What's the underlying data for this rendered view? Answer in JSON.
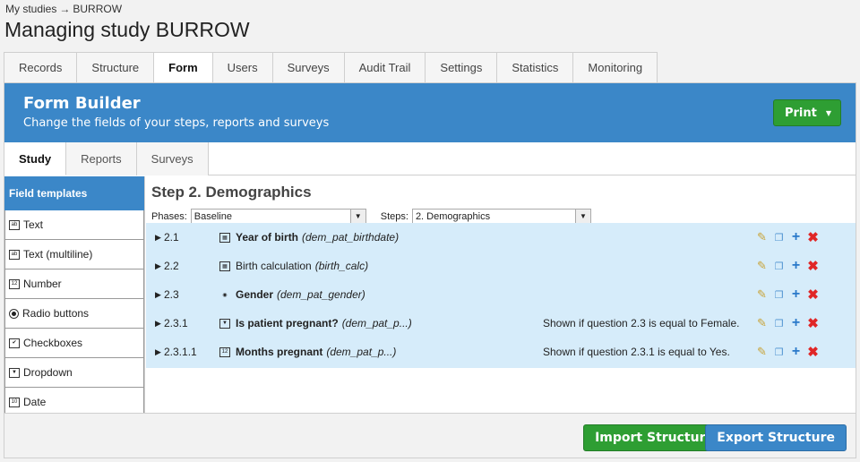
{
  "breadcrumb": {
    "root": "My studies",
    "arrow": "→",
    "current": "BURROW"
  },
  "page_title": "Managing study BURROW",
  "tabs": [
    "Records",
    "Structure",
    "Form",
    "Users",
    "Surveys",
    "Audit Trail",
    "Settings",
    "Statistics",
    "Monitoring"
  ],
  "active_tab": "Form",
  "banner": {
    "title": "Form Builder",
    "subtitle": "Change the fields of your steps, reports and surveys",
    "print_label": "Print",
    "print_caret": "▼"
  },
  "subtabs": [
    "Study",
    "Reports",
    "Surveys"
  ],
  "sidebar": {
    "heading": "Field templates",
    "items": [
      {
        "label": "Text",
        "icon": "text-icon",
        "glyph": "ab"
      },
      {
        "label": "Text (multiline)",
        "icon": "text-multiline-icon",
        "glyph": "ab"
      },
      {
        "label": "Number",
        "icon": "number-icon",
        "glyph": "12"
      },
      {
        "label": "Radio buttons",
        "icon": "radio-icon",
        "glyph": ""
      },
      {
        "label": "Checkboxes",
        "icon": "checkbox-icon",
        "glyph": "✔"
      },
      {
        "label": "Dropdown",
        "icon": "dropdown-icon",
        "glyph": "▼"
      },
      {
        "label": "Date",
        "icon": "date-icon",
        "glyph": "10"
      }
    ]
  },
  "step": {
    "title": "Step 2. Demographics",
    "phases_label": "Phases:",
    "phase_value": "Baseline",
    "steps_label": "Steps:",
    "step_value": "2. Demographics",
    "select_arrow": "▼"
  },
  "fields": [
    {
      "num": "2.1",
      "name": "Year of birth",
      "var": "(dem_pat_birthdate)",
      "bold": true,
      "icon": "calendar-icon",
      "glyph": "▦",
      "cond": ""
    },
    {
      "num": "2.2",
      "name": "Birth calculation",
      "var": "(birth_calc)",
      "bold": false,
      "icon": "calculation-icon",
      "glyph": "▦",
      "cond": ""
    },
    {
      "num": "2.3",
      "name": "Gender",
      "var": "(dem_pat_gender)",
      "bold": true,
      "icon": "radio-icon",
      "glyph": "◉",
      "cond": ""
    },
    {
      "num": "2.3.1",
      "name": "Is patient pregnant?",
      "var": "(dem_pat_p...)",
      "bold": true,
      "icon": "dropdown-icon",
      "glyph": "▼",
      "cond": "Shown if question 2.3 is equal to Female."
    },
    {
      "num": "2.3.1.1",
      "name": "Months pregnant",
      "var": "(dem_pat_p...)",
      "bold": true,
      "icon": "number-icon",
      "glyph": "12",
      "cond": "Shown if question 2.3.1 is equal to Yes."
    }
  ],
  "row_triangle": "▶",
  "action_glyphs": {
    "edit": "✎",
    "copy": "❐",
    "add": "+",
    "del": "✖"
  },
  "footer": {
    "import_label": "Import Structure",
    "export_label": "Export Structure"
  }
}
